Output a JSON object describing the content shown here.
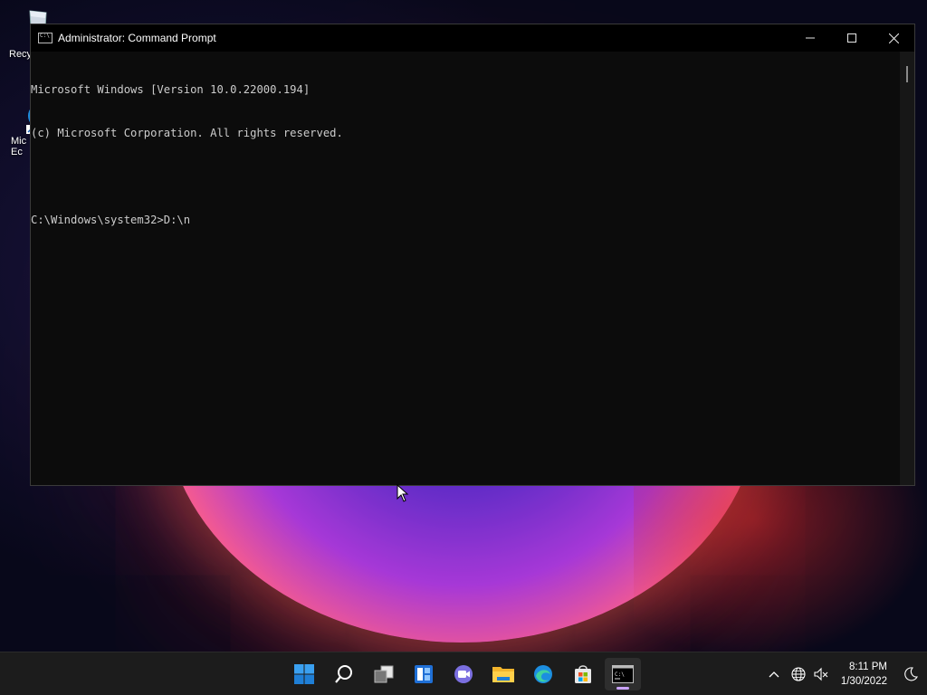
{
  "desktop": {
    "icons": [
      {
        "label": "Recy",
        "icon": "recycle-bin-icon"
      },
      {
        "label": "Mic Ec",
        "icon": "edge-shortcut-icon"
      }
    ]
  },
  "window": {
    "title": "Administrator: Command Prompt",
    "controls": [
      "minimize",
      "maximize",
      "close"
    ]
  },
  "console": {
    "lines": [
      "Microsoft Windows [Version 10.0.22000.194]",
      "(c) Microsoft Corporation. All rights reserved.",
      "",
      "C:\\Windows\\system32>D:\\n"
    ]
  },
  "taskbar": {
    "apps": [
      {
        "name": "start",
        "icon": "windows-start-icon"
      },
      {
        "name": "search",
        "icon": "search-icon"
      },
      {
        "name": "task-view",
        "icon": "task-view-icon"
      },
      {
        "name": "widgets",
        "icon": "widgets-icon"
      },
      {
        "name": "chat",
        "icon": "teams-chat-icon"
      },
      {
        "name": "file-explorer",
        "icon": "folder-icon"
      },
      {
        "name": "edge",
        "icon": "edge-icon"
      },
      {
        "name": "store",
        "icon": "store-icon"
      },
      {
        "name": "command-prompt",
        "icon": "terminal-icon",
        "active": true
      }
    ],
    "tray": {
      "icons": [
        "chevron-up-icon",
        "globe-icon",
        "speaker-muted-icon",
        "focus-moon-icon"
      ],
      "time": "8:11 PM",
      "date": "1/30/2022"
    }
  },
  "colors": {
    "console_bg": "#0c0c0c",
    "console_fg": "#cccccc",
    "taskbar_bg": "#1c1c1c",
    "active_indicator": "#c9a3ff"
  }
}
